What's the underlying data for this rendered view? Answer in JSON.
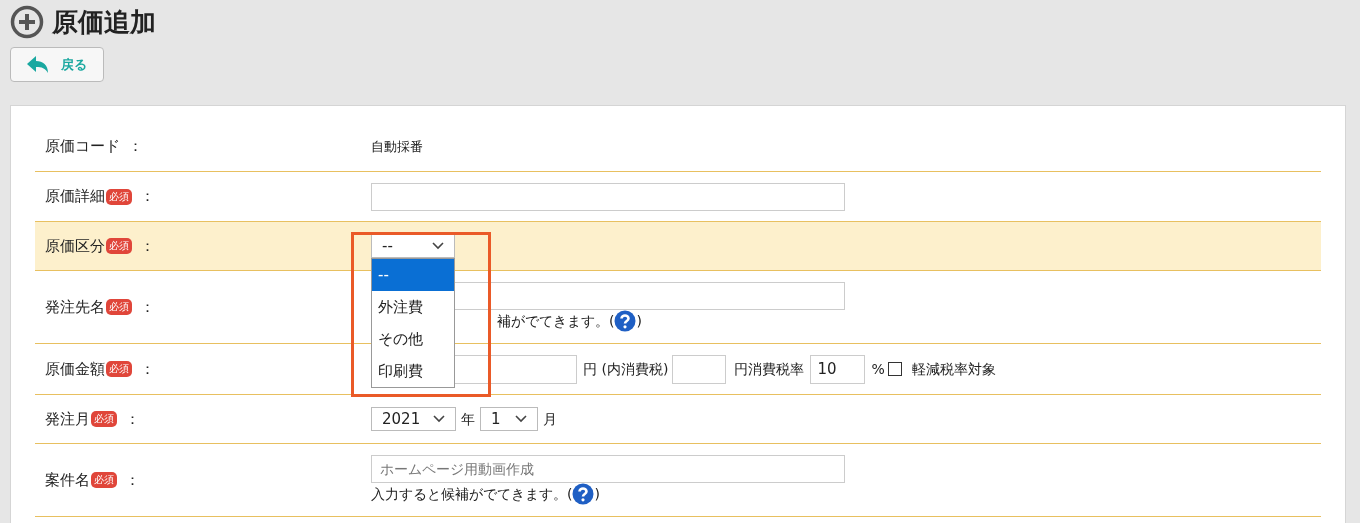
{
  "page": {
    "title": "原価追加",
    "back_button": "戻る"
  },
  "rows": [
    {
      "kind": "text",
      "label": "原価コード",
      "required": false,
      "highlighted": false,
      "colon": "：",
      "value": "自動採番"
    },
    {
      "kind": "input",
      "label": "原価詳細",
      "required": true,
      "badge": "必須",
      "highlighted": false,
      "colon": "："
    },
    {
      "kind": "dropdown",
      "label": "原価区分",
      "required": true,
      "badge": "必須",
      "highlighted": true,
      "colon": "：",
      "value": "--",
      "options": [
        {
          "label": "--",
          "selected": true
        },
        {
          "label": "外注費",
          "selected": false
        },
        {
          "label": "その他",
          "selected": false
        },
        {
          "label": "印刷費",
          "selected": false
        }
      ]
    },
    {
      "kind": "input_hint",
      "label": "発注先名",
      "required": true,
      "badge": "必須",
      "highlighted": false,
      "colon": "：",
      "hint": "補がでてきます。(",
      "hint_close": ")",
      "covered": true
    },
    {
      "kind": "amount",
      "label": "原価金額",
      "required": true,
      "badge": "必須",
      "highlighted": false,
      "colon": "：",
      "unit1": "円 (内消費税)",
      "unit2": "円消費税率",
      "rate": "10",
      "percent": "%",
      "reduced": {
        "label": "軽減税率対象",
        "checked": false
      }
    },
    {
      "kind": "month",
      "label": "発注月",
      "required": true,
      "badge": "必須",
      "highlighted": false,
      "colon": "：",
      "year": "2021",
      "year_unit": "年",
      "month": "1",
      "month_unit": "月"
    },
    {
      "kind": "input_hint",
      "label": "案件名",
      "required": true,
      "badge": "必須",
      "highlighted": false,
      "colon": "：",
      "placeholder": "ホームページ用動画作成",
      "hint": "入力すると候補がでてきます。(",
      "hint_close": ")",
      "covered": false
    }
  ]
}
